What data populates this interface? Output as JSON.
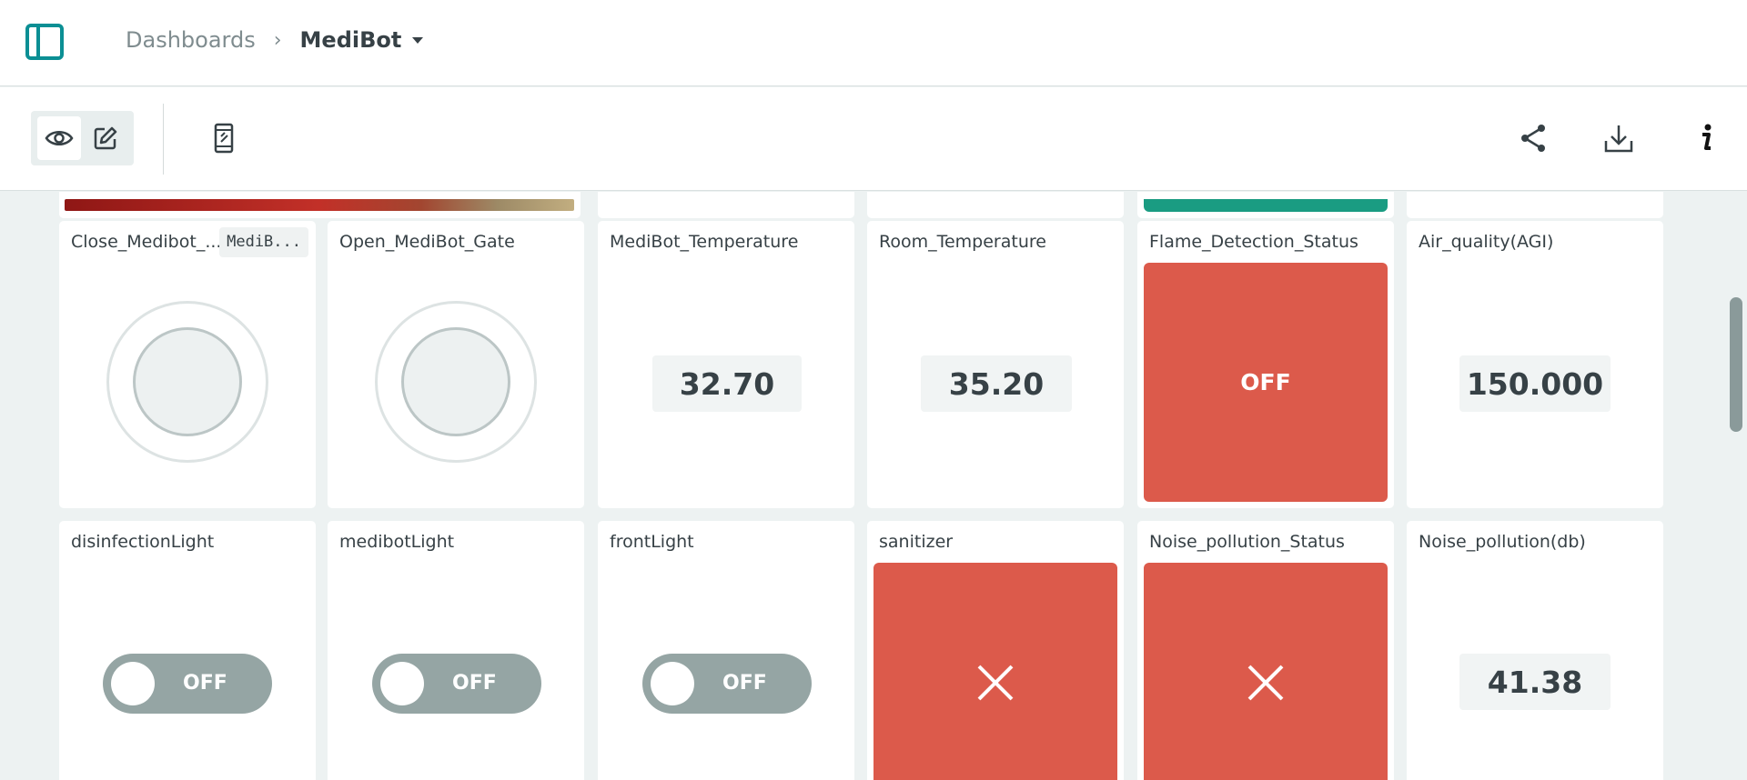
{
  "header": {
    "breadcrumb_root": "Dashboards",
    "breadcrumb_separator": "›",
    "dashboard_name": "MediBot"
  },
  "toolbar": {
    "icons": [
      "sidebar-toggle-icon",
      "eye-icon",
      "pencil-icon",
      "mobile-phone-icon",
      "share-icon",
      "download-icon",
      "info-icon"
    ]
  },
  "colors": {
    "accent": "#0b8f94",
    "status_red": "#dc5a4b",
    "switch_off": "#95a5a4",
    "green_bar": "#1a9c82"
  },
  "widgets": {
    "close_gate": {
      "title": "Close_Medibot_...",
      "tag": "MediB..."
    },
    "open_gate": {
      "title": "Open_MediBot_Gate"
    },
    "medibot_temp": {
      "title": "MediBot_Temperature",
      "value": "32.70"
    },
    "room_temp": {
      "title": "Room_Temperature",
      "value": "35.20"
    },
    "flame_status": {
      "title": "Flame_Detection_Status",
      "status": "OFF"
    },
    "air_quality": {
      "title": "Air_quality(AGI)",
      "value": "150.000"
    },
    "disinfection_light": {
      "title": "disinfectionLight",
      "state": "OFF"
    },
    "medibot_light": {
      "title": "medibotLight",
      "state": "OFF"
    },
    "front_light": {
      "title": "frontLight",
      "state": "OFF"
    },
    "sanitizer": {
      "title": "sanitizer",
      "icon": "close-x-icon"
    },
    "noise_status": {
      "title": "Noise_pollution_Status",
      "icon": "close-x-icon"
    },
    "noise_db": {
      "title": "Noise_pollution(db)",
      "value": "41.38"
    }
  }
}
